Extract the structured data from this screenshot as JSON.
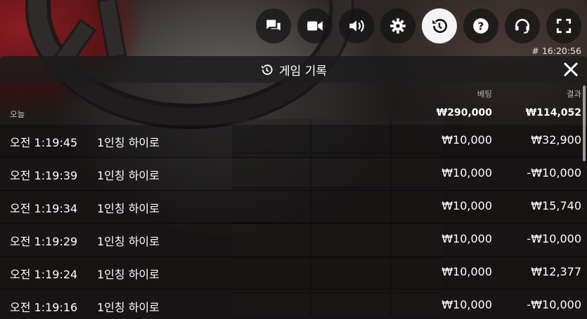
{
  "toolbar": {
    "buttons": [
      {
        "icon": "chat-icon",
        "active": false
      },
      {
        "icon": "video-camera-icon",
        "active": false
      },
      {
        "icon": "volume-icon",
        "active": false
      },
      {
        "icon": "gear-icon",
        "active": false
      },
      {
        "icon": "history-icon",
        "active": true
      },
      {
        "icon": "help-icon",
        "active": false
      },
      {
        "icon": "headset-icon",
        "active": false
      },
      {
        "icon": "fullscreen-icon",
        "active": false
      }
    ]
  },
  "clock": "# 16:20:56",
  "panel": {
    "title": "게임 기록",
    "columns": {
      "bet": "베팅",
      "result": "결과"
    },
    "summary": {
      "day": "오늘",
      "bet_total": "₩290,000",
      "result_total": "₩114,052"
    },
    "rows": [
      {
        "time": "오전 1:19:45",
        "game": "1인칭 하이로",
        "bet": "₩10,000",
        "result": "₩32,900"
      },
      {
        "time": "오전 1:19:39",
        "game": "1인칭 하이로",
        "bet": "₩10,000",
        "result": "-₩10,000"
      },
      {
        "time": "오전 1:19:34",
        "game": "1인칭 하이로",
        "bet": "₩10,000",
        "result": "₩15,740"
      },
      {
        "time": "오전 1:19:29",
        "game": "1인칭 하이로",
        "bet": "₩10,000",
        "result": "-₩10,000"
      },
      {
        "time": "오전 1:19:24",
        "game": "1인칭 하이로",
        "bet": "₩10,000",
        "result": "₩12,377"
      },
      {
        "time": "오전 1:19:16",
        "game": "1인칭 하이로",
        "bet": "₩10,000",
        "result": "-₩10,000"
      }
    ]
  },
  "colors": {
    "panel_bg": "#121212",
    "active_button": "#f4f4f4",
    "text": "#ffffff"
  }
}
